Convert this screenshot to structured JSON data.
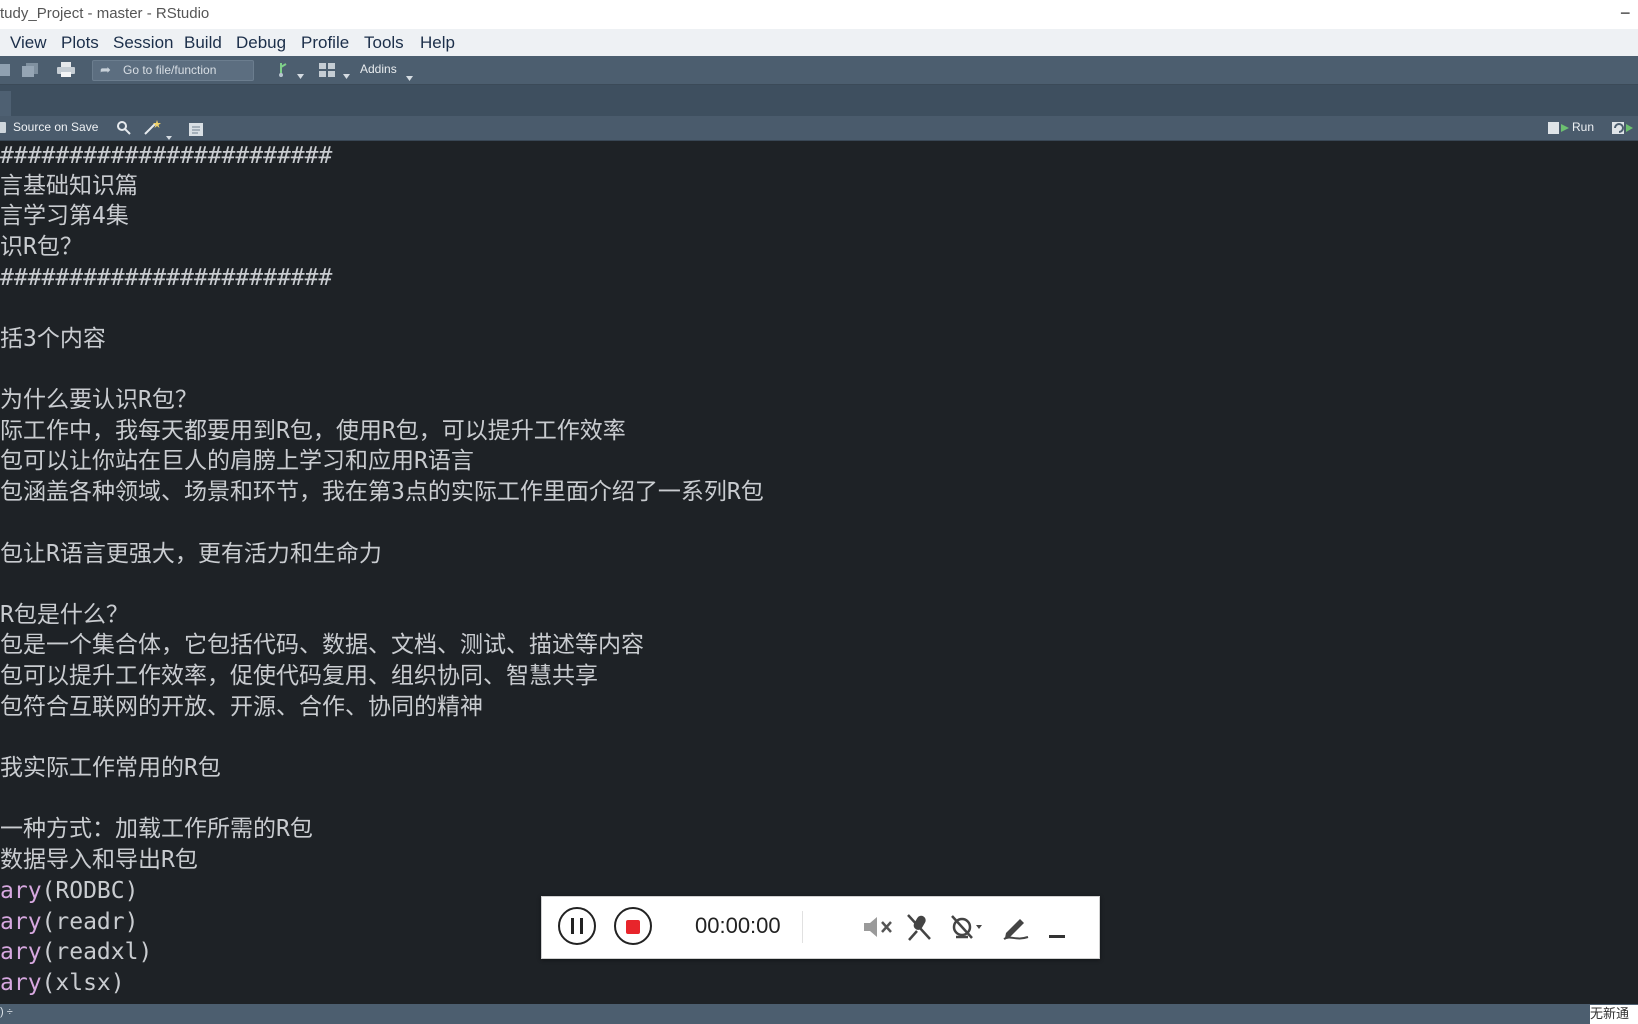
{
  "window": {
    "title": "tudy_Project - master - RStudio",
    "minimize_symbol": "−"
  },
  "menu": {
    "items": [
      "View",
      "Plots",
      "Session",
      "Build",
      "Debug",
      "Profile",
      "Tools",
      "Help"
    ]
  },
  "toolbar": {
    "goto_placeholder": "Go to file/function",
    "addins_label": "Addins"
  },
  "editor_toolbar": {
    "source_on_save": "Source on Save",
    "run_label": "Run"
  },
  "editor": {
    "lines": [
      {
        "text": "########################"
      },
      {
        "text": "言基础知识篇"
      },
      {
        "text": "言学习第4集"
      },
      {
        "text": "识R包？"
      },
      {
        "text": "########################"
      },
      {
        "text": ""
      },
      {
        "text": "括3个内容"
      },
      {
        "text": ""
      },
      {
        "text": "为什么要认识R包？"
      },
      {
        "text": "际工作中，我每天都要用到R包，使用R包，可以提升工作效率"
      },
      {
        "text": "包可以让你站在巨人的肩膀上学习和应用R语言"
      },
      {
        "text": "包涵盖各种领域、场景和环节，我在第3点的实际工作里面介绍了一系列R包"
      },
      {
        "text": ""
      },
      {
        "text": "包让R语言更强大，更有活力和生命力"
      },
      {
        "text": ""
      },
      {
        "text": "R包是什么？"
      },
      {
        "text": "包是一个集合体，它包括代码、数据、文档、测试、描述等内容"
      },
      {
        "text": "包可以提升工作效率，促使代码复用、组织协同、智慧共享"
      },
      {
        "text": "包符合互联网的开放、开源、合作、协同的精神"
      },
      {
        "text": ""
      },
      {
        "text": "我实际工作常用的R包"
      },
      {
        "text": ""
      },
      {
        "text": "一种方式：加载工作所需的R包"
      },
      {
        "text": "数据导入和导出R包"
      },
      {
        "fn": "ary",
        "arg": "(RODBC)"
      },
      {
        "fn": "ary",
        "arg": "(readr)"
      },
      {
        "fn": "ary",
        "arg": "(readxl)"
      },
      {
        "fn": "ary",
        "arg": "(xlsx)"
      }
    ]
  },
  "statusbar": {
    "text": ") ÷"
  },
  "corner_label": "无新通",
  "recorder": {
    "timer": "00:00:00",
    "pause_icon": "pause-icon",
    "stop_icon": "stop-icon",
    "speaker_icon": "speaker-muted-icon",
    "mic_icon": "mic-off-icon",
    "camera_icon": "camera-off-icon",
    "pen_icon": "pen-icon",
    "minimize_icon": "minimize-icon",
    "stop_color": "#e8252b"
  }
}
